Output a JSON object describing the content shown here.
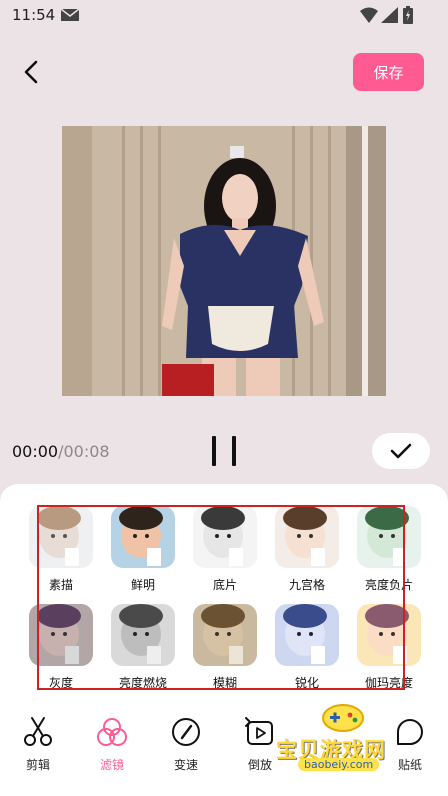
{
  "status_bar": {
    "time": "11:54",
    "icons": [
      "mail-icon",
      "wifi-icon",
      "signal-icon",
      "battery-icon"
    ]
  },
  "header": {
    "back_icon": "chevron-left-icon",
    "save_label": "保存"
  },
  "colors": {
    "accent": "#ff5b92",
    "background": "#ece3e6",
    "sheet": "#ffffff",
    "highlight_box": "#cc2222"
  },
  "player": {
    "current_time": "00:00",
    "separator": "/",
    "total_time": "00:08",
    "state": "playing",
    "pause_icon": "pause-icon",
    "confirm_icon": "check-icon"
  },
  "filters": [
    {
      "label": "素描"
    },
    {
      "label": "鲜明"
    },
    {
      "label": "底片"
    },
    {
      "label": "九宫格"
    },
    {
      "label": "亮度负片"
    },
    {
      "label": "灰度"
    },
    {
      "label": "亮度燃烧"
    },
    {
      "label": "模糊"
    },
    {
      "label": "锐化"
    },
    {
      "label": "伽玛亮度"
    }
  ],
  "toolbar": {
    "items": [
      {
        "label": "剪辑",
        "icon": "scissors-icon"
      },
      {
        "label": "滤镜",
        "icon": "filter-circles-icon",
        "active": true
      },
      {
        "label": "变速",
        "icon": "speedometer-icon"
      },
      {
        "label": "倒放",
        "icon": "reverse-play-icon"
      },
      {
        "label": "贴纸",
        "icon": "sticker-icon"
      }
    ]
  },
  "watermark": {
    "title": "宝贝游戏网",
    "url": "baobeiy.com"
  }
}
